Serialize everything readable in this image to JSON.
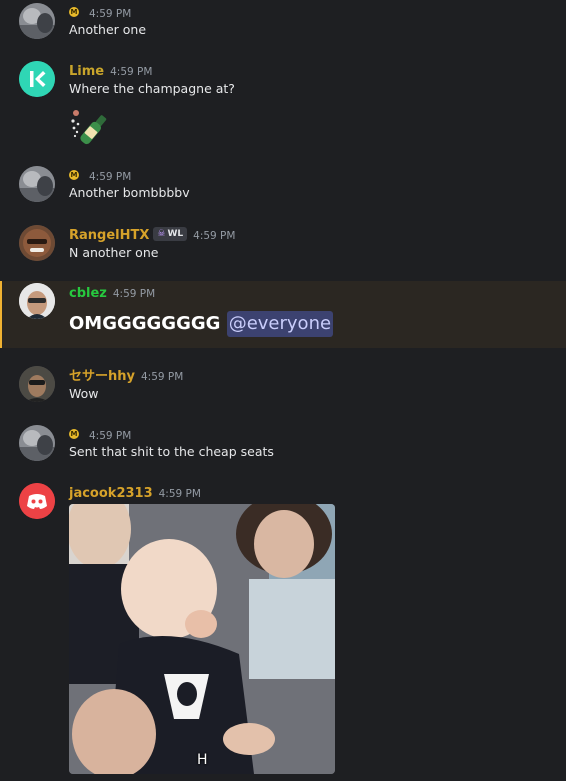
{
  "messages": [
    {
      "username": "",
      "time": "4:59 PM",
      "text": "Another one"
    },
    {
      "username": "Lime",
      "time": "4:59 PM",
      "text": "Where the champagne at?",
      "emoji": "bottle-with-popping-cork"
    },
    {
      "username": "",
      "time": "4:59 PM",
      "text": "Another bombbbbv"
    },
    {
      "username": "RangelHTX",
      "tag": "WL",
      "time": "4:59 PM",
      "text": "N another one"
    },
    {
      "username": "cblez",
      "time": "4:59 PM",
      "text": "OMGGGGGGGG",
      "mention": "@everyone"
    },
    {
      "username": "セサーhhy",
      "time": "4:59 PM",
      "text": "Wow"
    },
    {
      "username": "",
      "time": "4:59 PM",
      "text": "Sent that shit to the cheap seats"
    },
    {
      "username": "jacook2313",
      "time": "4:59 PM",
      "gif_caption": "H"
    }
  ],
  "colors": {
    "background": "#1e1f22",
    "highlight_bg": "#2b2722",
    "highlight_border": "#f0b232",
    "username_gold": "#d6a22a",
    "username_green": "#27c93f",
    "mention_bg": "#3c4270",
    "discord_red": "#ed4245",
    "lime_teal": "#2fd6b5"
  }
}
